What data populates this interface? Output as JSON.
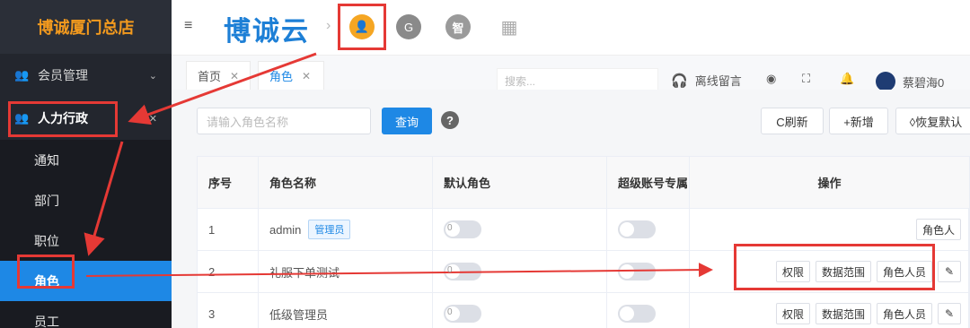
{
  "sidebar": {
    "brand": "博诚厦门总店",
    "items": [
      {
        "label": "会员管理",
        "icon": "users-icon"
      },
      {
        "label": "人力行政",
        "icon": "group-icon"
      }
    ],
    "sub_items": [
      "通知",
      "部门",
      "职位",
      "角色",
      "员工"
    ]
  },
  "topbar": {
    "logo": "博诚云",
    "apps": [
      {
        "icon": "user-app-icon",
        "glyph": "👤"
      },
      {
        "icon": "swirl-app-icon",
        "glyph": "G"
      },
      {
        "icon": "zhi-app-icon",
        "glyph": "智"
      },
      {
        "icon": "grid-app-icon",
        "glyph": "▦"
      }
    ]
  },
  "tabs": [
    {
      "label": "首页"
    },
    {
      "label": "角色"
    }
  ],
  "header_tools": {
    "search_placeholder": "搜索...",
    "message": "离线留言",
    "user_name": "蔡碧海0"
  },
  "filter": {
    "placeholder": "请输入角色名称",
    "query_label": "查询",
    "refresh_label": "C刷新",
    "add_label": "+新增",
    "restore_label": "◊恢复默认"
  },
  "table": {
    "headers": [
      "序号",
      "角色名称",
      "默认角色",
      "超级账号专属",
      "操作"
    ],
    "rows": [
      {
        "index": "1",
        "name": "admin",
        "tag": "管理员",
        "ops": [
          "角色人"
        ]
      },
      {
        "index": "2",
        "name": "礼服下单测试",
        "tag": "",
        "ops": [
          "权限",
          "数据范围",
          "角色人员"
        ]
      },
      {
        "index": "3",
        "name": "低级管理员",
        "tag": "",
        "ops": [
          "权限",
          "数据范围",
          "角色人员"
        ]
      }
    ],
    "switch_text": "0"
  },
  "colors": {
    "accent": "#1e88e5",
    "brand": "#f39a1e",
    "sidebar_bg": "#23262e",
    "annotation": "#e53935"
  }
}
